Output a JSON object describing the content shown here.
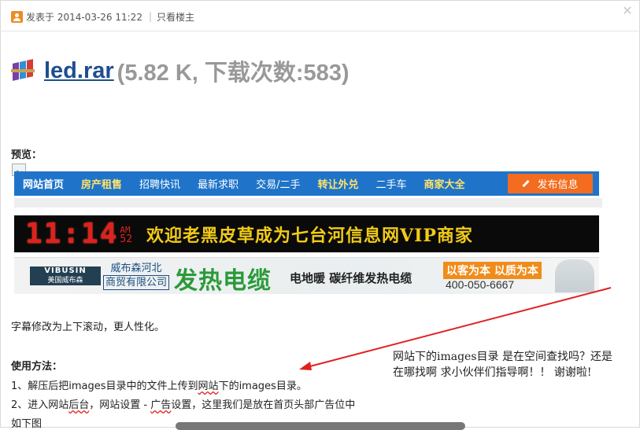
{
  "post": {
    "meta_text": "发表于 2014-03-26 11:22",
    "only_author": "只看楼主"
  },
  "attachment": {
    "filename": "led.rar",
    "info": "(5.82 K, 下载次数:583)"
  },
  "preview_label": "预览：",
  "site_nav": {
    "items": [
      "网站首页",
      "房产租售",
      "招聘快讯",
      "最新求职",
      "交易/二手",
      "转让外兑",
      "二手车",
      "商家大全"
    ],
    "publish": "发布信息"
  },
  "led_banner": {
    "clock": "11:14",
    "ampm": "AM",
    "seconds": "52",
    "text": "欢迎老黑皮草成为七台河信息网VIP商家"
  },
  "ad_banner": {
    "logo_en": "VIBUSIN",
    "logo_cn": "美国威布森",
    "company_line1": "威布森河北",
    "company_line2": "商贸有限公司",
    "headline": "发热电缆",
    "subline": "电地暖 碳纤维发热电缆",
    "slogan": "以客为本 以质为本",
    "phone": "400-050-6667"
  },
  "content": {
    "line1": "字幕修改为上下滚动，更人性化。",
    "usage_title": "使用方法：",
    "step1_prefix": "1、解压后把images目录中的文件上传到",
    "step1_link": "网站",
    "step1_suffix": "下的images目录。",
    "step2_prefix": "2、进入网站",
    "step2_link1": "后台",
    "step2_mid": "，网站设置 - ",
    "step2_link2": "广告",
    "step2_suffix": "设置，这里我们是放在首页头部广告位中",
    "line_last": "如下图"
  },
  "annotation": {
    "line1": "网站下的images目录 是在空间查找吗？还是",
    "line2": "在哪找啊 求小伙伴们指导啊！！ 谢谢啦!"
  },
  "colors": {
    "nav_blue": "#1f74c9",
    "publish_orange": "#f36c1f",
    "led_red": "#e0211d",
    "led_yellow": "#f2cb16",
    "link_blue": "#1f4e8f",
    "arrow_red": "#e02020"
  }
}
